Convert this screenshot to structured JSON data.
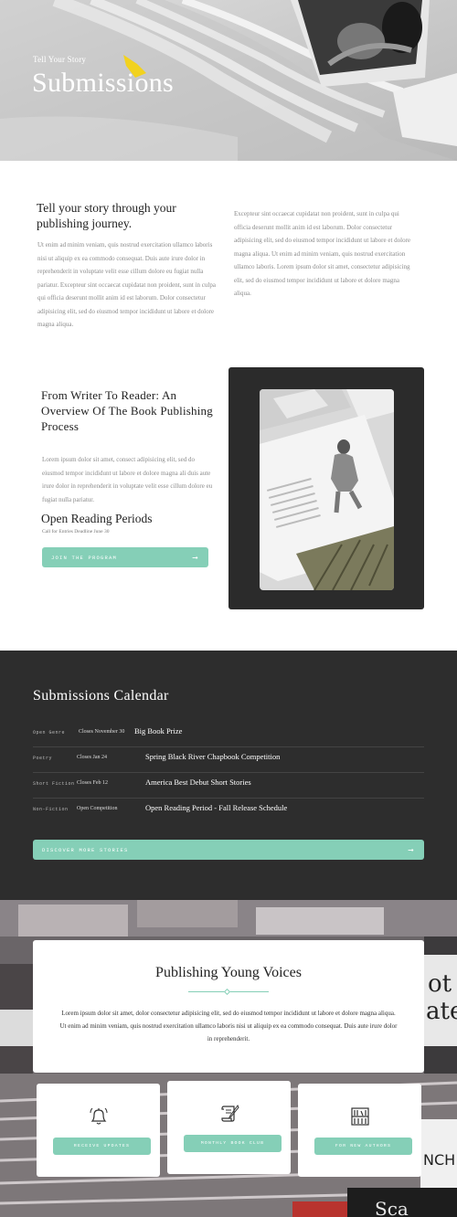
{
  "hero": {
    "kicker": "Tell Your Story",
    "title": "Submissions"
  },
  "intro": {
    "heading": "Tell your story through your publishing journey.",
    "left_text": "Ut enim ad minim veniam, quis nostrud exercitation ullamco laboris nisi ut aliquip ex ea commodo consequat. Duis aute irure dolor in reprehenderit in voluptate velit esse cillum dolore eu fugiat nulla pariatur. Excepteur sint occaecat cupidatat non proident, sunt in culpa qui officia deserunt mollit anim id est laborum. Dolor consectetur adipisicing elit, sed do eiusmod tempor incididunt ut labore et dolore magna aliqua.",
    "right_text": "Excepteur sint occaecat cupidatat non proident, sunt in culpa qui officia deserunt mollit anim id est laborum. Dolor consectetur adipisicing elit, sed do eiusmod tempor incididunt ut labore et dolore magna aliqua. Ut enim ad minim veniam, quis nostrud exercitation ullamco laboris. Lorem ipsum dolor sit amet, consectetur adipisicing elit, sed do eiusmod tempor incididunt ut labore et dolore magna aliqua."
  },
  "feature": {
    "title": "From Writer To Reader: An Overview Of The Book Publishing Process",
    "text": "Lorem ipsum dolor sit amet, consect adipisicing elit, sed do eiusmod tempor incididunt ut  labore et dolore magna ali duis aute irure dolor in reprehenderit in voluptate velit esse cillum dolore eu fugiat nulla pariatur.",
    "reading_title": "Open Reading Periods",
    "reading_sub": "Call for Entries Deadline June 30",
    "button_label": "JOIN THE PROGRAM",
    "button_icon": "arrow-right-icon"
  },
  "calendar": {
    "title": "Submissions Calendar",
    "rows": [
      {
        "genre": "Open Genre",
        "date": "Closes November 30",
        "name": "Big Book Prize"
      },
      {
        "genre": "Poetry",
        "date": "Closes Jan 24",
        "name": "Spring Black River Chapbook Competition"
      },
      {
        "genre": "Short Fiction",
        "date": "Closes Feb 12",
        "name": "America Best Debut Short Stories"
      },
      {
        "genre": "Non-Fiction",
        "date": "Open Competition",
        "name": "Open Reading Period - Fall Release Schedule"
      }
    ],
    "button_label": "DISCOVER MORE STORIES"
  },
  "voices": {
    "title": "Publishing Young Voices",
    "text": "Lorem ipsum dolor sit amet, dolor consectetur adipisicing elit, sed do eiusmod tempor incididunt ut labore et dolore magna aliqua. Ut enim ad minim veniam, quis nostrud exercitation ullamco laboris nisi ut aliquip ex ea commodo consequat. Duis aute irure dolor in reprehenderit."
  },
  "cards": [
    {
      "icon": "bell-icon",
      "label": "RECEIVE UPDATES"
    },
    {
      "icon": "scroll-quill-icon",
      "label": "MONTHLY BOOK CLUB"
    },
    {
      "icon": "bookshelf-icon",
      "label": "FOR NEW AUTHORS"
    }
  ],
  "colors": {
    "accent": "#85cfb7",
    "dark_section": "#2d2d2d"
  }
}
